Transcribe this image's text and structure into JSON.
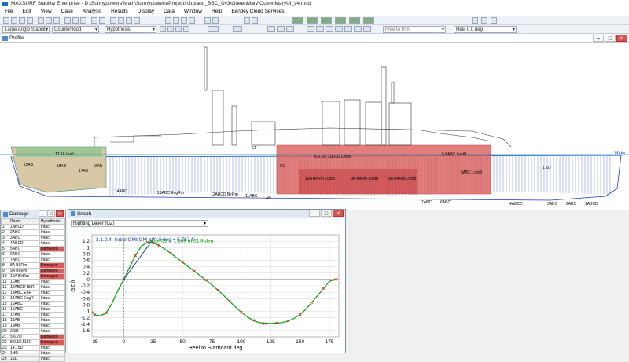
{
  "app": {
    "title": "MAXSURF Stability Enterprise - D:\\Sunnypowers\\Main\\Sunnypowers\\Projects\\Jutland_BBC_Uv3\\QueenMary\\QueenMaryUI_v4.msd"
  },
  "menu": [
    "File",
    "Edit",
    "View",
    "Case",
    "Analysis",
    "Results",
    "Display",
    "Data",
    "Window",
    "Help",
    "Bentley Cloud Services"
  ],
  "toolbar2": {
    "analysis_type": "Large Angle Stability",
    "flood_method": "Counterflood",
    "hypothesis": "Hypothesis",
    "trim": "Free to trim",
    "heel": "Heel 0.0 deg"
  },
  "profile": {
    "title": "Profile",
    "water_label": "Water",
    "compartment_labels": [
      {
        "text": "17.16 Void"
      },
      {
        "text": "18AB"
      },
      {
        "text": "16AB"
      },
      {
        "text": "17AB"
      },
      {
        "text": "15AB"
      },
      {
        "text": "14ABC"
      },
      {
        "text": "13ABC EngRm"
      },
      {
        "text": "12ABCD BlrRm"
      },
      {
        "text": "11ABC"
      },
      {
        "text": "8.9.10: 11ECD LostB"
      },
      {
        "text": "10A BlrRm LostB"
      },
      {
        "text": "9A BlrRm LostB"
      },
      {
        "text": "5A BlrRm LostB"
      },
      {
        "text": "5ABC LostB"
      },
      {
        "text": "4ABCD"
      },
      {
        "text": "3ABC"
      },
      {
        "text": "2ABC"
      },
      {
        "text": "1ABCD"
      },
      {
        "text": "AB"
      },
      {
        "text": "CF"
      },
      {
        "text": "CG"
      },
      {
        "text": "5.6ABC LostB"
      },
      {
        "text": "7ABC"
      },
      {
        "text": "6ABC"
      },
      {
        "text": "1.2D"
      }
    ]
  },
  "damage": {
    "title": "Damage",
    "columns": [
      "",
      "Room",
      "Hypothesis"
    ],
    "rows": [
      [
        "1",
        "1ABCD",
        "Intact"
      ],
      [
        "2",
        "2ABC",
        "Intact"
      ],
      [
        "3",
        "3ABC",
        "Intact"
      ],
      [
        "4",
        "4ABCD",
        "Intact"
      ],
      [
        "5",
        "5ABC",
        "Damaged"
      ],
      [
        "6",
        "6ABC",
        "Intact"
      ],
      [
        "7",
        "7ABC",
        "Intact"
      ],
      [
        "8",
        "8A BlrRm",
        "Damaged"
      ],
      [
        "9",
        "9A BlrRm",
        "Damaged"
      ],
      [
        "10",
        "10A BlrRm",
        "Damaged"
      ],
      [
        "11",
        "11AB",
        "Intact"
      ],
      [
        "12",
        "12ABCD BlrR",
        "Intact"
      ],
      [
        "13",
        "13ABC EnR",
        "Intact"
      ],
      [
        "14",
        "14ABC EngR",
        "Intact"
      ],
      [
        "15",
        "15ABC",
        "Intact"
      ],
      [
        "16",
        "16ABC",
        "Intact"
      ],
      [
        "17",
        "17AB",
        "Intact"
      ],
      [
        "18",
        "18AB",
        "Intact"
      ],
      [
        "19",
        "19AB",
        "Intact"
      ],
      [
        "20",
        "2.3D",
        "Intact"
      ],
      [
        "21",
        "5.6.7D",
        "Damaged"
      ],
      [
        "22",
        "8.9.10.11EC",
        "Damaged"
      ],
      [
        "23",
        "14.15D",
        "Intact"
      ],
      [
        "24",
        "1HD",
        "Intact"
      ],
      [
        "25",
        "16D",
        "Intact"
      ]
    ]
  },
  "graph": {
    "title": "Graph",
    "selector": "Righting Lever (GZ)",
    "annotation_gm": "3.1.2.4: Initial GMt GM at 0.0 deg = 5.787 ft",
    "annotation_max": "Max GZ = 1.168 at 21.8 deg"
  },
  "chart_data": {
    "type": "line",
    "xlabel": "Heel to Starboard deg",
    "ylabel": "GZ ft",
    "xlim": [
      -27,
      183
    ],
    "ylim": [
      -1.8,
      1.4
    ],
    "xticks": [
      -25,
      0,
      25,
      50,
      75,
      100,
      125,
      150,
      175
    ],
    "yticks": [
      1.2,
      1,
      0.8,
      0.6,
      0.4,
      0.2,
      0,
      -0.2,
      -0.4,
      -0.6,
      -0.8,
      -1,
      -1.2,
      -1.4,
      -1.6
    ],
    "series": [
      {
        "x": [
          -27,
          -25,
          -20,
          -15,
          -10,
          -5,
          0,
          5,
          10,
          15,
          20,
          21.8,
          25,
          30,
          35,
          40,
          45,
          50,
          55,
          60,
          65,
          70,
          75,
          80,
          85,
          90,
          95,
          100,
          105,
          110,
          115,
          120,
          125,
          130,
          135,
          140,
          145,
          150,
          155,
          160,
          165,
          170,
          175,
          180
        ],
        "y": [
          -1.0,
          -1.1,
          -1.14,
          -1.05,
          -0.75,
          -0.35,
          0,
          0.38,
          0.75,
          1.05,
          1.16,
          1.168,
          1.15,
          1.07,
          0.95,
          0.82,
          0.68,
          0.54,
          0.4,
          0.26,
          0.12,
          -0.02,
          -0.17,
          -0.33,
          -0.5,
          -0.68,
          -0.86,
          -1.03,
          -1.17,
          -1.28,
          -1.35,
          -1.38,
          -1.38,
          -1.37,
          -1.35,
          -1.3,
          -1.22,
          -1.1,
          -0.93,
          -0.72,
          -0.5,
          -0.28,
          -0.06,
          0.0
        ],
        "markers_x": [
          -25,
          -15,
          0,
          10,
          20,
          25,
          30,
          40,
          50,
          60,
          70,
          80,
          90,
          100,
          110,
          120,
          130,
          140,
          150,
          160,
          170,
          180
        ],
        "color": "#00a000",
        "marker_color": "#e02020"
      }
    ]
  },
  "colors": {
    "damaged": "#d9534f",
    "profile_line": "#1a3fb0",
    "gm_line": "#1a3fb0",
    "curve": "#00a000"
  }
}
